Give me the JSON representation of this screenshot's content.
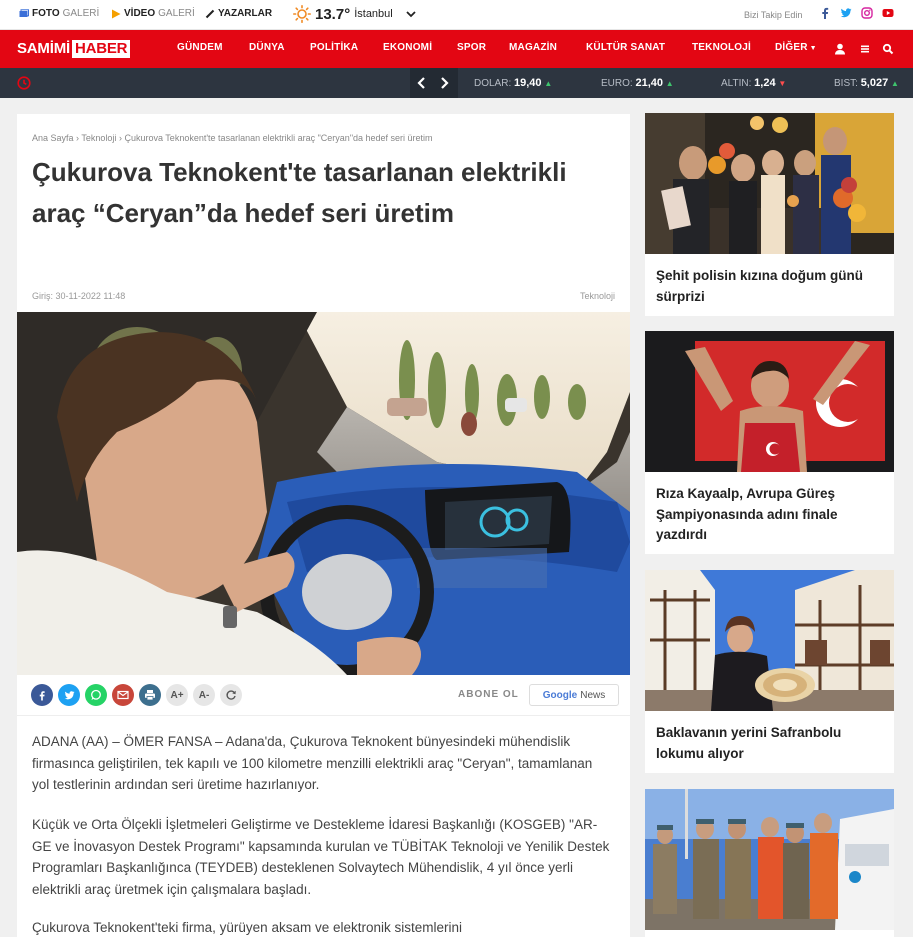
{
  "topbar": {
    "foto_bold": "FOTO",
    "foto_light": "GALERİ",
    "video_bold": "VİDEO",
    "video_light": "GALERİ",
    "yazarlar": "YAZARLAR",
    "temperature": "13.7°",
    "city": "İstanbul",
    "follow_text": "Bizi Takip Edin"
  },
  "nav": {
    "logo_part1": "SAMİMİ",
    "logo_part2": "HABER",
    "items": [
      "GÜNDEM",
      "DÜNYA",
      "POLİTİKA",
      "EKONOMİ",
      "SPOR",
      "MAGAZİN",
      "KÜLTÜR SANAT",
      "TEKNOLOJİ",
      "DİĞER"
    ]
  },
  "markets": [
    {
      "label": "DOLAR:",
      "value": "19,40",
      "trend": "up"
    },
    {
      "label": "EURO:",
      "value": "21,40",
      "trend": "up"
    },
    {
      "label": "ALTIN:",
      "value": "1,24",
      "trend": "down"
    },
    {
      "label": "BIST:",
      "value": "5,027",
      "trend": "up"
    }
  ],
  "article": {
    "breadcrumb": [
      "Ana Sayfa",
      "Teknoloji",
      "Çukurova Teknokent'te tasarlanan elektrikli araç \"Ceryan\"da hedef seri üretim"
    ],
    "breadcrumb_sep": "›",
    "title": "Çukurova Teknokent'te tasarlanan elektrikli araç “Ceryan”da hedef seri üretim",
    "date": "Giriş: 30-11-2022 11:48",
    "category": "Teknoloji",
    "paragraphs": [
      "ADANA (AA) – ÖMER FANSA – Adana'da, Çukurova Teknokent bünyesindeki mühendislik firmasınca geliştirilen, tek kapılı ve 100 kilometre menzilli elektrikli araç \"Ceryan\", tamamlanan yol testlerinin ardından seri üretime hazırlanıyor.",
      "Küçük ve Orta Ölçekli İşletmeleri Geliştirme ve Destekleme İdaresi Başkanlığı (KOSGEB) \"AR-GE ve İnovasyon Destek Programı\" kapsamında kurulan ve TÜBİTAK Teknoloji ve Yenilik Destek Programları Başkanlığınca (TEYDEB) desteklenen Solvaytech Mühendislik, 4 yıl önce yerli elektrikli araç üretmek için çalışmalara başladı.",
      "Çukurova Teknokent'teki firma, yürüyen aksam ve elektronik sistemlerini"
    ]
  },
  "share": {
    "font_plus": "A+",
    "font_minus": "A-",
    "abone": "ABONE OL",
    "gnews_google": "Google",
    "gnews_news": "News"
  },
  "sidebar": [
    {
      "caption": "Şehit polisin kızına doğum günü sürprizi"
    },
    {
      "caption": "Rıza Kayaalp, Avrupa Güreş Şampiyonasında adını finale yazdırdı"
    },
    {
      "caption": "Baklavanın yerini Safranbolu lokumu alıyor"
    },
    {
      "caption": ""
    }
  ],
  "colors": {
    "brand_red": "#e30613",
    "ticker_bg": "#2d3540",
    "facebook": "#3b5998",
    "twitter": "#1da1f2",
    "whatsapp": "#25d366",
    "mail": "#c8463a",
    "print": "#3d6f8e"
  }
}
